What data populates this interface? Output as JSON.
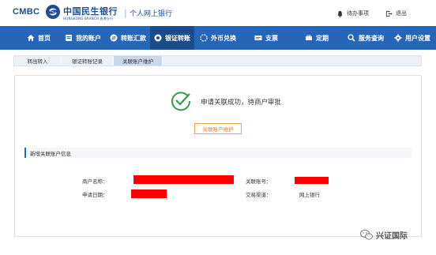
{
  "header": {
    "logo_en": "CMBC",
    "logo_cn": "中国民生银行",
    "logo_sub": "HONGKONG BRANCH 香港分行",
    "separator": "|",
    "title": "个人网上银行",
    "todo_label": "待办事项",
    "logout_label": "退出"
  },
  "nav": {
    "items": [
      {
        "label": "首页",
        "icon": "home-icon"
      },
      {
        "label": "我的账户",
        "icon": "account-icon"
      },
      {
        "label": "转账汇款",
        "icon": "transfer-icon"
      },
      {
        "label": "银证转账",
        "icon": "securities-transfer-icon",
        "active": true
      },
      {
        "label": "外币兑换",
        "icon": "exchange-icon"
      },
      {
        "label": "支票",
        "icon": "cheque-icon"
      },
      {
        "label": "定期",
        "icon": "deposit-icon"
      },
      {
        "label": "服务查询",
        "icon": "search-icon"
      },
      {
        "label": "用户设置",
        "icon": "gear-icon"
      }
    ]
  },
  "subtabs": {
    "items": [
      {
        "label": "转出转入"
      },
      {
        "label": "银证转账记录"
      },
      {
        "label": "关联账户维护",
        "active": true
      }
    ]
  },
  "result": {
    "message": "申请关联成功，待商户审批",
    "button_label": "关联账户维护"
  },
  "info": {
    "section_title": "新增关联账户信息",
    "merchant_name_label": "商户名称：",
    "assoc_account_label": "关联账号：",
    "apply_date_label": "申请日期：",
    "channel_label": "交易渠道：",
    "channel_value": "网上银行"
  },
  "watermark": {
    "text": "兴证国际"
  },
  "colors": {
    "brand_blue": "#1b4d96",
    "nav_blue": "#2566b9",
    "nav_active": "#1a4c8d",
    "success_green": "#3a9a4a",
    "accent_orange": "#ee7a1e",
    "redaction": "#ff0000"
  }
}
